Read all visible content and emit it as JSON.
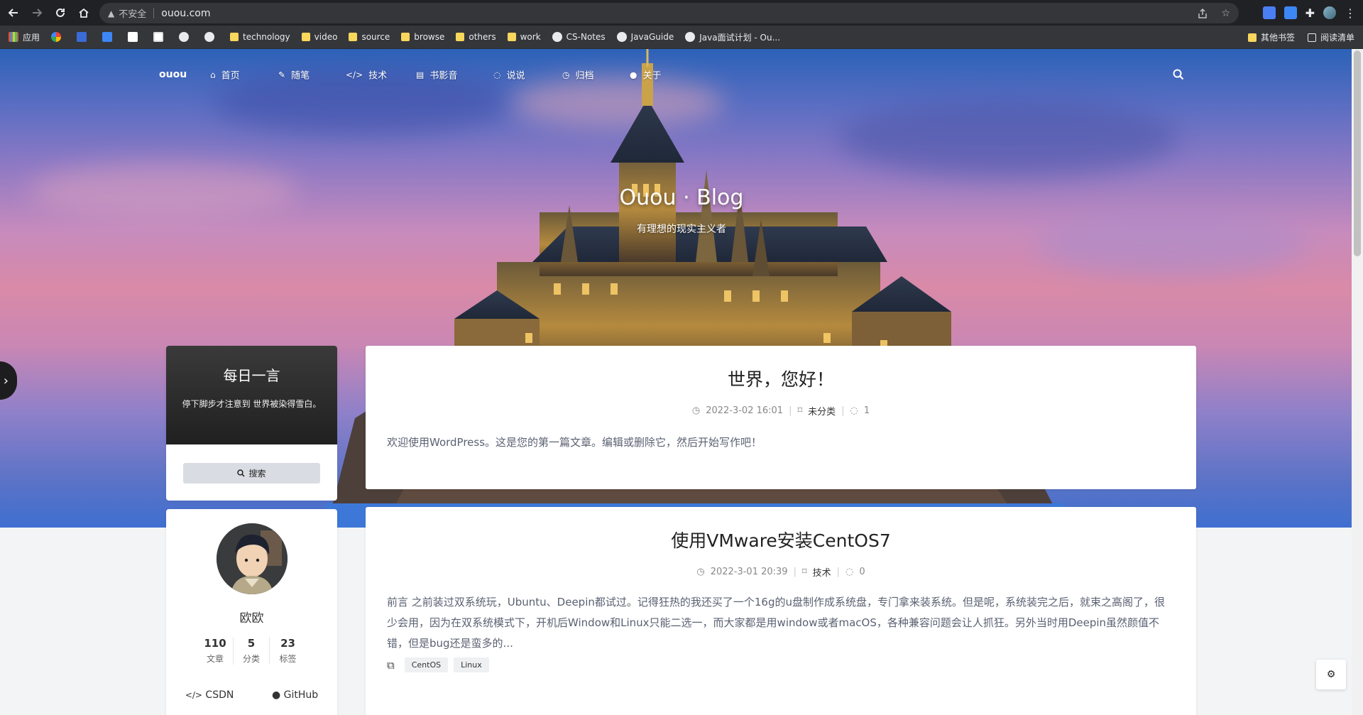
{
  "browser": {
    "insecure_label": "不安全",
    "url": "ouou.com"
  },
  "bookmarks": {
    "items": [
      {
        "label": "应用",
        "icon": "apps-icon"
      },
      {
        "label": "",
        "icon": "google-icon"
      },
      {
        "label": "",
        "icon": "baidu-icon"
      },
      {
        "label": "",
        "icon": "pen-icon"
      },
      {
        "label": "",
        "icon": "trello-icon"
      },
      {
        "label": "",
        "icon": "wordpress-icon"
      },
      {
        "label": "",
        "icon": "paw-icon"
      },
      {
        "label": "",
        "icon": "github-icon"
      },
      {
        "label": "technology",
        "icon": "folder-icon"
      },
      {
        "label": "video",
        "icon": "folder-icon"
      },
      {
        "label": "source",
        "icon": "folder-icon"
      },
      {
        "label": "browse",
        "icon": "folder-icon"
      },
      {
        "label": "others",
        "icon": "folder-icon"
      },
      {
        "label": "work",
        "icon": "folder-icon"
      },
      {
        "label": "CS-Notes",
        "icon": "github-icon"
      },
      {
        "label": "JavaGuide",
        "icon": "github-icon"
      },
      {
        "label": "Java面试计划 - Ou...",
        "icon": "paw-icon"
      }
    ],
    "other_bookmarks": "其他书签",
    "reading_list": "阅读清单"
  },
  "site": {
    "brand": "ouou",
    "nav": [
      {
        "label": "首页",
        "icon": "home-icon"
      },
      {
        "label": "随笔",
        "icon": "pencil-icon"
      },
      {
        "label": "技术",
        "icon": "code-icon"
      },
      {
        "label": "书影音",
        "icon": "book-icon"
      },
      {
        "label": "说说",
        "icon": "comments-icon"
      },
      {
        "label": "归档",
        "icon": "clock-icon"
      },
      {
        "label": "关于",
        "icon": "user-icon"
      }
    ],
    "hero_title": "Ouou · Blog",
    "hero_subtitle": "有理想的现实主义者"
  },
  "sidebar": {
    "quote_title": "每日一言",
    "quote_text": "停下脚步才注意到 世界被染得雪白。",
    "search_label": "搜索",
    "profile": {
      "name": "欧欧",
      "stats": [
        {
          "num": "110",
          "label": "文章"
        },
        {
          "num": "5",
          "label": "分类"
        },
        {
          "num": "23",
          "label": "标签"
        }
      ],
      "links": [
        {
          "label": "CSDN",
          "icon": "code-icon"
        },
        {
          "label": "GitHub",
          "icon": "github-icon"
        }
      ]
    }
  },
  "posts": [
    {
      "title": "世界，您好！",
      "date": "2022-3-02 16:01",
      "category": "未分类",
      "comments": "1",
      "excerpt": "欢迎使用WordPress。这是您的第一篇文章。编辑或删除它，然后开始写作吧！",
      "tags": []
    },
    {
      "title": "使用VMware安装CentOS7",
      "date": "2022-3-01 20:39",
      "category": "技术",
      "comments": "0",
      "excerpt": "前言 之前装过双系统玩，Ubuntu、Deepin都试过。记得狂热的我还买了一个16g的u盘制作成系统盘，专门拿来装系统。但是呢，系统装完之后，就束之高阁了，很少会用，因为在双系统模式下，开机后Window和Linux只能二选一，而大家都是用window或者macOS，各种兼容问题会让人抓狂。另外当时用Deepin虽然颜值不错，但是bug还是蛮多的...",
      "tags": [
        "CentOS",
        "Linux"
      ]
    }
  ]
}
